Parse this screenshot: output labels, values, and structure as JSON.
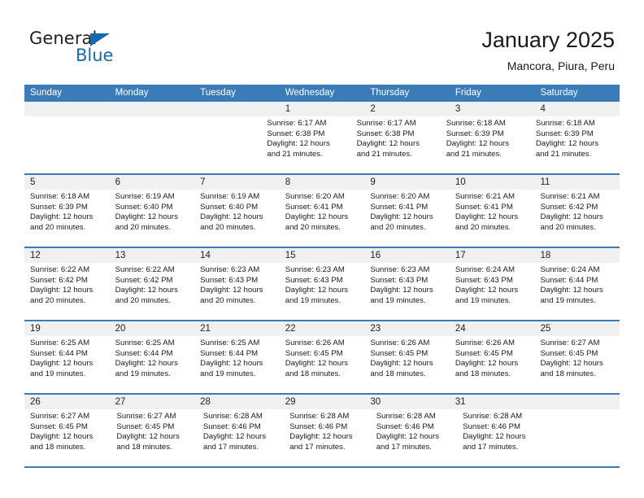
{
  "brand": {
    "name_top": "General",
    "name_bottom": "Blue",
    "accent_color": "#1769b0"
  },
  "header": {
    "title": "January 2025",
    "location": "Mancora, Piura, Peru"
  },
  "theme": {
    "header_row_color": "#3b7cb8",
    "daynum_strip_color": "#f0f0f0"
  },
  "calendar": {
    "weekdays": [
      "Sunday",
      "Monday",
      "Tuesday",
      "Wednesday",
      "Thursday",
      "Friday",
      "Saturday"
    ],
    "weeks": [
      [
        {
          "day": "",
          "lines": []
        },
        {
          "day": "",
          "lines": []
        },
        {
          "day": "",
          "lines": []
        },
        {
          "day": "1",
          "lines": [
            "Sunrise: 6:17 AM",
            "Sunset: 6:38 PM",
            "Daylight: 12 hours",
            "and 21 minutes."
          ]
        },
        {
          "day": "2",
          "lines": [
            "Sunrise: 6:17 AM",
            "Sunset: 6:38 PM",
            "Daylight: 12 hours",
            "and 21 minutes."
          ]
        },
        {
          "day": "3",
          "lines": [
            "Sunrise: 6:18 AM",
            "Sunset: 6:39 PM",
            "Daylight: 12 hours",
            "and 21 minutes."
          ]
        },
        {
          "day": "4",
          "lines": [
            "Sunrise: 6:18 AM",
            "Sunset: 6:39 PM",
            "Daylight: 12 hours",
            "and 21 minutes."
          ]
        }
      ],
      [
        {
          "day": "5",
          "lines": [
            "Sunrise: 6:18 AM",
            "Sunset: 6:39 PM",
            "Daylight: 12 hours",
            "and 20 minutes."
          ]
        },
        {
          "day": "6",
          "lines": [
            "Sunrise: 6:19 AM",
            "Sunset: 6:40 PM",
            "Daylight: 12 hours",
            "and 20 minutes."
          ]
        },
        {
          "day": "7",
          "lines": [
            "Sunrise: 6:19 AM",
            "Sunset: 6:40 PM",
            "Daylight: 12 hours",
            "and 20 minutes."
          ]
        },
        {
          "day": "8",
          "lines": [
            "Sunrise: 6:20 AM",
            "Sunset: 6:41 PM",
            "Daylight: 12 hours",
            "and 20 minutes."
          ]
        },
        {
          "day": "9",
          "lines": [
            "Sunrise: 6:20 AM",
            "Sunset: 6:41 PM",
            "Daylight: 12 hours",
            "and 20 minutes."
          ]
        },
        {
          "day": "10",
          "lines": [
            "Sunrise: 6:21 AM",
            "Sunset: 6:41 PM",
            "Daylight: 12 hours",
            "and 20 minutes."
          ]
        },
        {
          "day": "11",
          "lines": [
            "Sunrise: 6:21 AM",
            "Sunset: 6:42 PM",
            "Daylight: 12 hours",
            "and 20 minutes."
          ]
        }
      ],
      [
        {
          "day": "12",
          "lines": [
            "Sunrise: 6:22 AM",
            "Sunset: 6:42 PM",
            "Daylight: 12 hours",
            "and 20 minutes."
          ]
        },
        {
          "day": "13",
          "lines": [
            "Sunrise: 6:22 AM",
            "Sunset: 6:42 PM",
            "Daylight: 12 hours",
            "and 20 minutes."
          ]
        },
        {
          "day": "14",
          "lines": [
            "Sunrise: 6:23 AM",
            "Sunset: 6:43 PM",
            "Daylight: 12 hours",
            "and 20 minutes."
          ]
        },
        {
          "day": "15",
          "lines": [
            "Sunrise: 6:23 AM",
            "Sunset: 6:43 PM",
            "Daylight: 12 hours",
            "and 19 minutes."
          ]
        },
        {
          "day": "16",
          "lines": [
            "Sunrise: 6:23 AM",
            "Sunset: 6:43 PM",
            "Daylight: 12 hours",
            "and 19 minutes."
          ]
        },
        {
          "day": "17",
          "lines": [
            "Sunrise: 6:24 AM",
            "Sunset: 6:43 PM",
            "Daylight: 12 hours",
            "and 19 minutes."
          ]
        },
        {
          "day": "18",
          "lines": [
            "Sunrise: 6:24 AM",
            "Sunset: 6:44 PM",
            "Daylight: 12 hours",
            "and 19 minutes."
          ]
        }
      ],
      [
        {
          "day": "19",
          "lines": [
            "Sunrise: 6:25 AM",
            "Sunset: 6:44 PM",
            "Daylight: 12 hours",
            "and 19 minutes."
          ]
        },
        {
          "day": "20",
          "lines": [
            "Sunrise: 6:25 AM",
            "Sunset: 6:44 PM",
            "Daylight: 12 hours",
            "and 19 minutes."
          ]
        },
        {
          "day": "21",
          "lines": [
            "Sunrise: 6:25 AM",
            "Sunset: 6:44 PM",
            "Daylight: 12 hours",
            "and 19 minutes."
          ]
        },
        {
          "day": "22",
          "lines": [
            "Sunrise: 6:26 AM",
            "Sunset: 6:45 PM",
            "Daylight: 12 hours",
            "and 18 minutes."
          ]
        },
        {
          "day": "23",
          "lines": [
            "Sunrise: 6:26 AM",
            "Sunset: 6:45 PM",
            "Daylight: 12 hours",
            "and 18 minutes."
          ]
        },
        {
          "day": "24",
          "lines": [
            "Sunrise: 6:26 AM",
            "Sunset: 6:45 PM",
            "Daylight: 12 hours",
            "and 18 minutes."
          ]
        },
        {
          "day": "25",
          "lines": [
            "Sunrise: 6:27 AM",
            "Sunset: 6:45 PM",
            "Daylight: 12 hours",
            "and 18 minutes."
          ]
        }
      ],
      [
        {
          "day": "26",
          "lines": [
            "Sunrise: 6:27 AM",
            "Sunset: 6:45 PM",
            "Daylight: 12 hours",
            "and 18 minutes."
          ]
        },
        {
          "day": "27",
          "lines": [
            "Sunrise: 6:27 AM",
            "Sunset: 6:45 PM",
            "Daylight: 12 hours",
            "and 18 minutes."
          ]
        },
        {
          "day": "28",
          "lines": [
            "Sunrise: 6:28 AM",
            "Sunset: 6:46 PM",
            "Daylight: 12 hours",
            "and 17 minutes."
          ]
        },
        {
          "day": "29",
          "lines": [
            "Sunrise: 6:28 AM",
            "Sunset: 6:46 PM",
            "Daylight: 12 hours",
            "and 17 minutes."
          ]
        },
        {
          "day": "30",
          "lines": [
            "Sunrise: 6:28 AM",
            "Sunset: 6:46 PM",
            "Daylight: 12 hours",
            "and 17 minutes."
          ]
        },
        {
          "day": "31",
          "lines": [
            "Sunrise: 6:28 AM",
            "Sunset: 6:46 PM",
            "Daylight: 12 hours",
            "and 17 minutes."
          ]
        },
        {
          "day": "",
          "lines": []
        }
      ]
    ]
  }
}
